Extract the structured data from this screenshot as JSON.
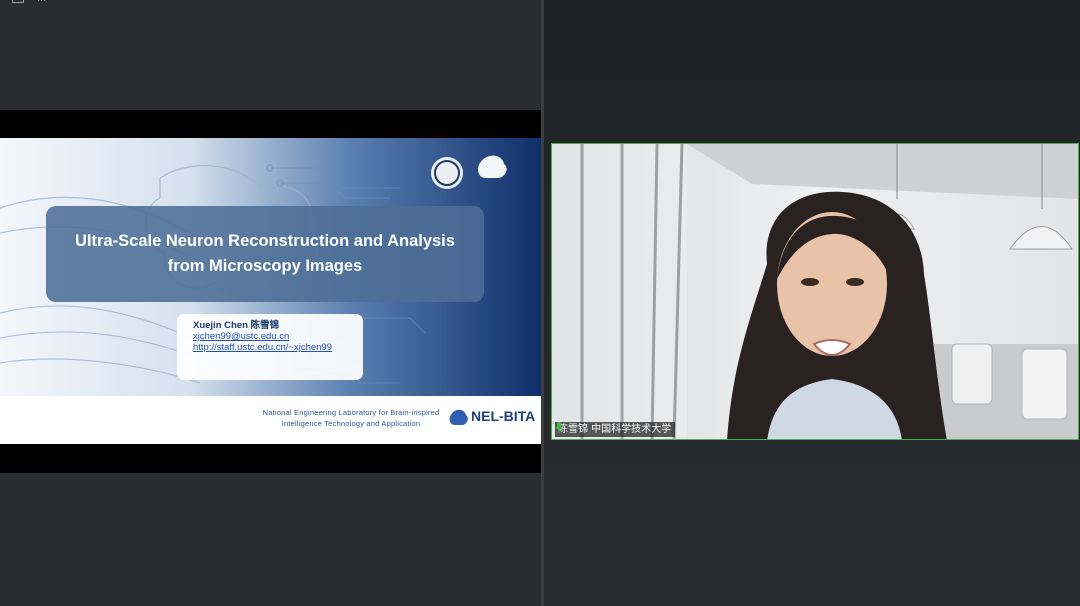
{
  "window": {
    "top_label": "..."
  },
  "slide": {
    "title_line1": "Ultra-Scale Neuron Reconstruction and Analysis",
    "title_line2": "from Microscopy Images",
    "author_name": "Xuejin Chen 陈雪锦",
    "email": "xjchen99@ustc.edu.cn",
    "homepage": "http://staff.ustc.edu.cn/~xjchen99",
    "footer_line1": "National Engineering Laboratory for Brain-inspired",
    "footer_line2": "Intelligence Technology and Application",
    "logo_text": "NEL-BITA",
    "small_logo_text": "NEL BITA"
  },
  "participant": {
    "name_tag": "陈雪锦 中国科学技术大学",
    "mic_state": "active"
  },
  "colors": {
    "slide_navy": "#1d3c6b",
    "tile_border": "#4bb24b",
    "mic": "#3fbf3f"
  }
}
